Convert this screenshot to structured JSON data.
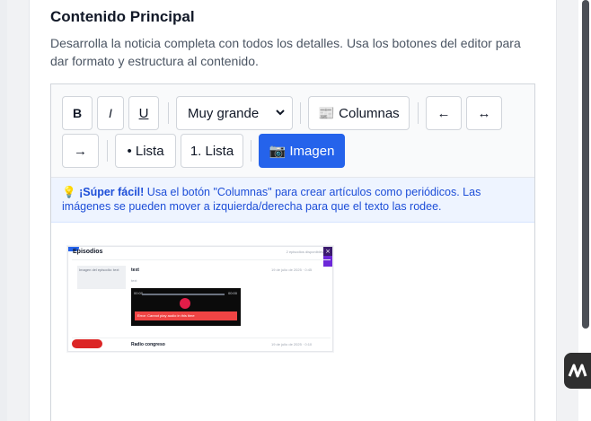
{
  "section": {
    "title": "Contenido Principal",
    "description": "Desarrolla la noticia completa con todos los detalles. Usa los botones del editor para dar formato y estructura al contenido."
  },
  "toolbar": {
    "bold": "B",
    "italic": "I",
    "underline": "U",
    "font_size_value": "Muy grande",
    "columns": "📰 Columnas",
    "align_left": "←",
    "align_center": "↔",
    "align_right": "→",
    "bullet_list": "• Lista",
    "numbered_list": "1. Lista",
    "image": "📷 Imagen"
  },
  "tip": {
    "icon": "💡",
    "bold": "¡Súper fácil!",
    "text": " Usa el botón \"Columnas\" para crear artículos como periódicos. Las imágenes se pueden mover a izquierda/derecha para que el texto las rodee."
  },
  "embedded_screenshot": {
    "title": "Episodios",
    "count": "2 episodios disponibles",
    "row1": {
      "thumb_alt": "Imagen del episodio: text",
      "name": "text",
      "sub": "text",
      "date": "19 de julio de 2025 · 0:45",
      "player_time_left": "00:00",
      "player_time_right": "00:00",
      "player_error": "Error: Cannot play audio in this time"
    },
    "row2": {
      "thumb_alt": "Imagen del episodio:",
      "name": "Radio congreso",
      "date": "19 de julio de 2025 · 0:10"
    }
  },
  "colors": {
    "primary": "#2563eb",
    "tip_bg": "#eef4ff",
    "tip_text": "#1d4ed8"
  }
}
